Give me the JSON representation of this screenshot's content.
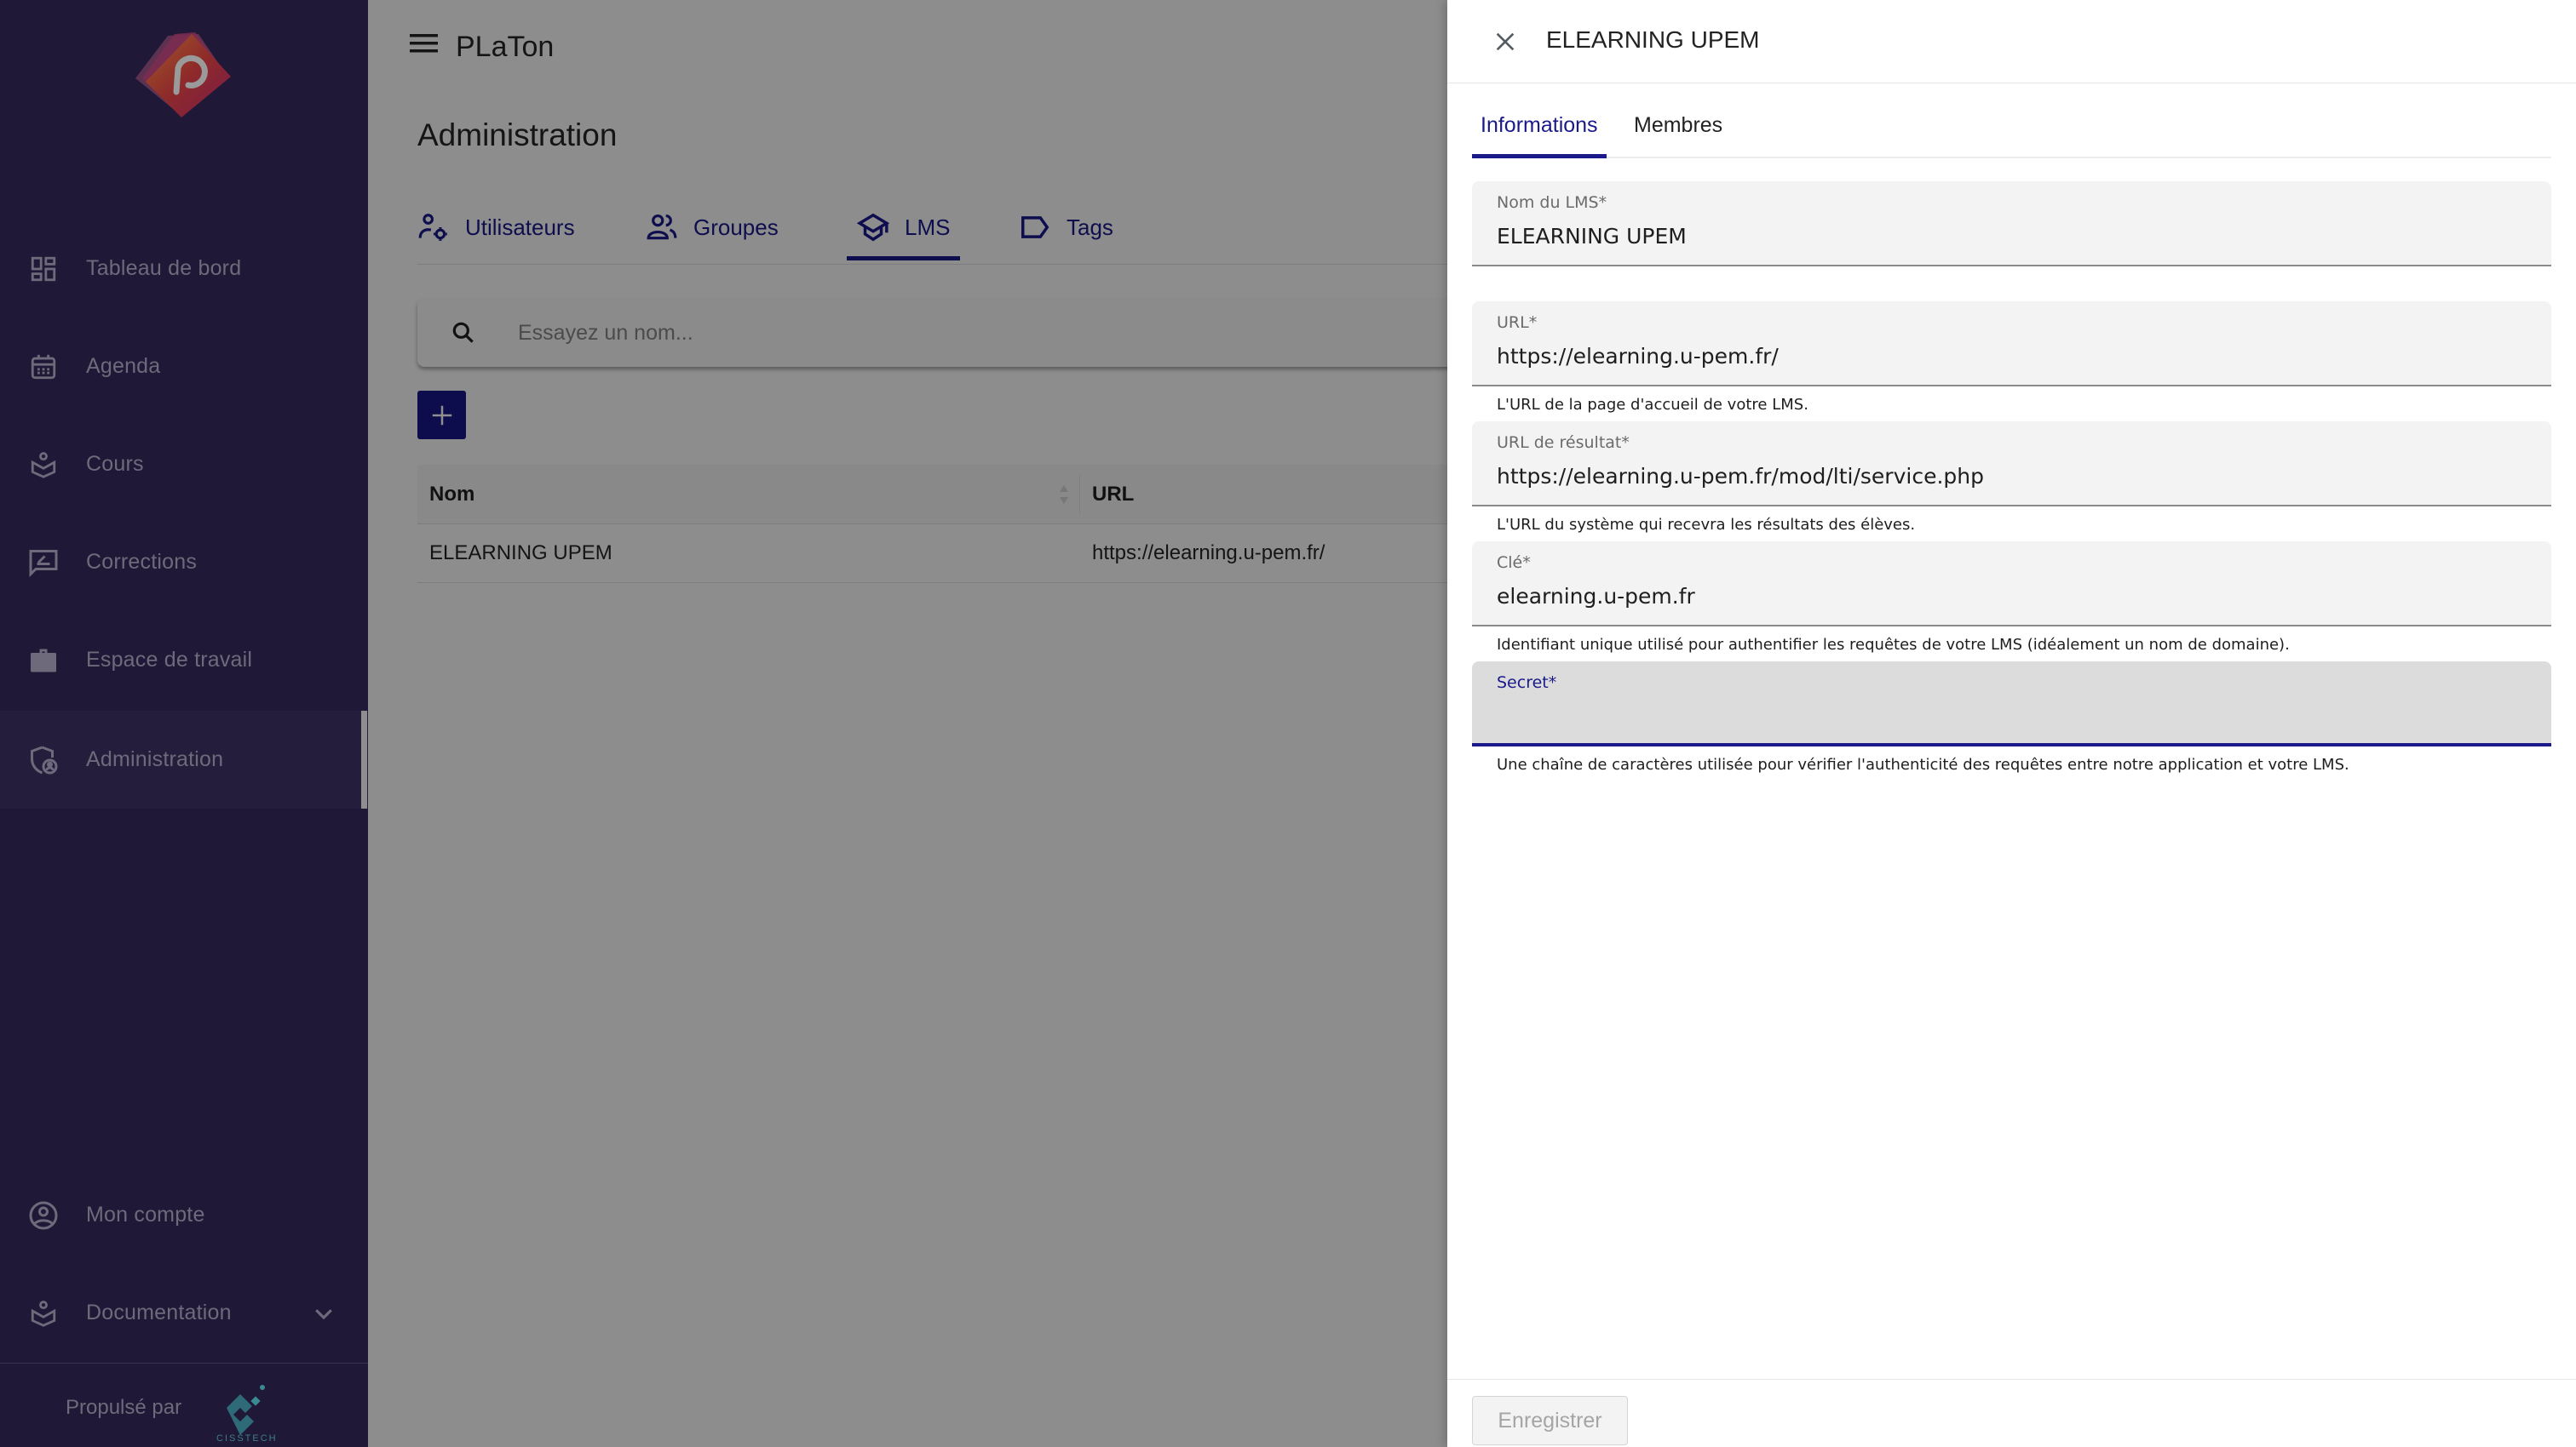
{
  "app": {
    "title": "PLaTon"
  },
  "sidebar": {
    "items": [
      {
        "label": "Tableau de bord",
        "icon": "dashboard-icon"
      },
      {
        "label": "Agenda",
        "icon": "calendar-icon"
      },
      {
        "label": "Cours",
        "icon": "course-book-icon"
      },
      {
        "label": "Corrections",
        "icon": "correction-icon"
      },
      {
        "label": "Espace de travail",
        "icon": "briefcase-icon"
      },
      {
        "label": "Administration",
        "icon": "admin-shield-icon",
        "active": true
      }
    ],
    "bottom_items": [
      {
        "label": "Mon compte",
        "icon": "account-circle-icon"
      },
      {
        "label": "Documentation",
        "icon": "documentation-icon",
        "expandable": true
      }
    ],
    "powered_by": "Propulsé par",
    "powered_by_brand": "CISSTECH"
  },
  "main": {
    "page_title": "Administration",
    "tabs": [
      {
        "label": "Utilisateurs",
        "icon": "user-settings-icon"
      },
      {
        "label": "Groupes",
        "icon": "group-icon"
      },
      {
        "label": "LMS",
        "icon": "school-icon",
        "active": true
      },
      {
        "label": "Tags",
        "icon": "tag-icon"
      }
    ],
    "search": {
      "placeholder": "Essayez un nom..."
    },
    "add_button_label": "+",
    "table": {
      "columns": [
        "Nom",
        "URL"
      ],
      "rows": [
        [
          "ELEARNING UPEM",
          "https://elearning.u-pem.fr/"
        ]
      ]
    }
  },
  "panel": {
    "title": "ELEARNING UPEM",
    "tabs": [
      {
        "label": "Informations",
        "active": true
      },
      {
        "label": "Membres"
      }
    ],
    "fields": [
      {
        "label": "Nom du LMS*",
        "value": "ELEARNING UPEM",
        "hint": ""
      },
      {
        "label": "URL*",
        "value": "https://elearning.u-pem.fr/",
        "hint": "L'URL de la page d'accueil de votre LMS."
      },
      {
        "label": "URL de résultat*",
        "value": "https://elearning.u-pem.fr/mod/lti/service.php",
        "hint": "L'URL du système qui recevra les résultats des élèves."
      },
      {
        "label": "Clé*",
        "value": "elearning.u-pem.fr",
        "hint": "Identifiant unique utilisé pour authentifier les requêtes de votre LMS (idéalement un nom de domaine)."
      },
      {
        "label": "Secret*",
        "value": "",
        "hint": "Une chaîne de caractères utilisée pour vérifier l'authenticité des requêtes entre notre application et votre LMS.",
        "focused": true
      }
    ],
    "save_label": "Enregistrer"
  },
  "colors": {
    "sidebar_bg": "#1f1836",
    "accent": "#1a1a8a",
    "overlay": "#8d8d8d",
    "add_button": "#0d0d4d"
  }
}
